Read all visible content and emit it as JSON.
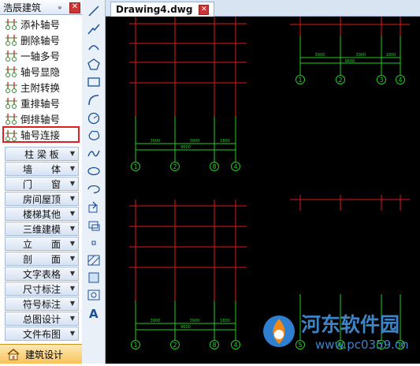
{
  "palette": {
    "title": "浩辰建筑",
    "pin": "ᵩ",
    "close": "✕",
    "commands": [
      {
        "label": "添补轴号",
        "icon": "axis-add-icon"
      },
      {
        "label": "删除轴号",
        "icon": "axis-delete-icon"
      },
      {
        "label": "一轴多号",
        "icon": "axis-multi-number-icon"
      },
      {
        "label": "轴号显隐",
        "icon": "axis-show-hide-icon"
      },
      {
        "label": "主附转换",
        "icon": "axis-main-sub-convert-icon"
      },
      {
        "label": "重排轴号",
        "icon": "axis-renumber-icon"
      },
      {
        "label": "倒排轴号",
        "icon": "axis-reverse-icon"
      },
      {
        "label": "轴号连接",
        "icon": "axis-connect-icon",
        "selected": true
      }
    ],
    "categories": [
      "柱 梁 板",
      "墙　　体",
      "门　　窗",
      "房间屋顶",
      "楼梯其他",
      "三维建模",
      "立　　面",
      "剖　　面",
      "文字表格",
      "尺寸标注",
      "符号标注",
      "总图设计",
      "文件布图"
    ],
    "bottom_tab": "建筑设计"
  },
  "toolbar": {
    "tools": [
      "line-icon",
      "polyline-icon",
      "arc-polyline-icon",
      "polygon-icon",
      "rectangle-icon",
      "arc-icon",
      "circle-icon",
      "revision-cloud-icon",
      "spline-icon",
      "ellipse-icon",
      "ellipse-arc-icon",
      "insert-block-icon",
      "make-block-icon",
      "point-icon",
      "hatch-icon",
      "region-icon",
      "table-icon",
      "text-icon"
    ]
  },
  "document": {
    "tab_label": "Drawing4.dwg",
    "close": "✕"
  },
  "drawing": {
    "dimension_labels_a": [
      "3900",
      "3900",
      "1800",
      "9600"
    ],
    "axis_numbers_a": [
      "1",
      "2",
      "3",
      "4"
    ],
    "dimension_labels_b": [
      "3900",
      "3900",
      "1800",
      "9600"
    ],
    "axis_numbers_b": [
      "1",
      "2",
      "8",
      "4"
    ],
    "dimension_labels_c": [
      "3900",
      "3900",
      "1800",
      "9600"
    ],
    "axis_numbers_c": [
      "1",
      "2",
      "8",
      "4"
    ],
    "axis_numbers_d": [
      "5",
      "6",
      "7",
      "8"
    ],
    "colors": {
      "axis": "#e01818",
      "dimension": "#22cc22",
      "background": "#000000"
    }
  },
  "watermark": {
    "text": "河东软件园",
    "url": "www.pc0359.cn"
  }
}
